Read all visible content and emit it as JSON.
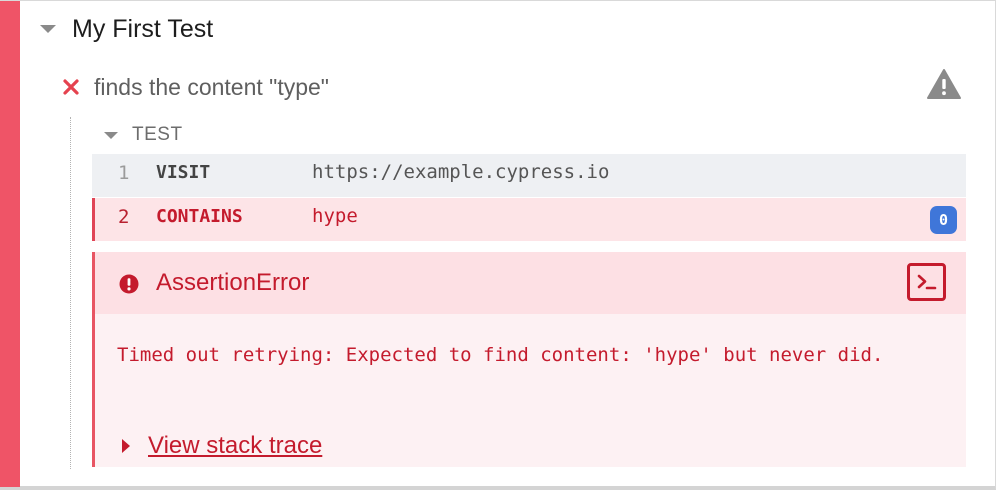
{
  "suite": {
    "title": "My First Test"
  },
  "test": {
    "title": "finds the content \"type\"",
    "status": "failed"
  },
  "section": {
    "label": "TEST"
  },
  "commands": [
    {
      "number": "1",
      "method": "VISIT",
      "message": "https://example.cypress.io"
    },
    {
      "number": "2",
      "method": "CONTAINS",
      "message": "hype",
      "badge": "0"
    }
  ],
  "error": {
    "name": "AssertionError",
    "message": "Timed out retrying: Expected to find content: 'hype' but never did.",
    "stack_link": "View stack trace"
  },
  "icons": {
    "suite_toggle": "chevron-down-icon",
    "test_status": "close-icon",
    "test_warning": "warning-icon",
    "section_toggle": "chevron-down-icon",
    "error": "alert-circle-icon",
    "console": "terminal-icon",
    "stack_toggle": "chevron-right-icon"
  },
  "colors": {
    "failed_bar": "#ef5467",
    "error_text": "#c41b2d",
    "error_bg": "#fdf1f3",
    "error_header_bg": "#fde0e4",
    "badge": "#3f76d9"
  }
}
